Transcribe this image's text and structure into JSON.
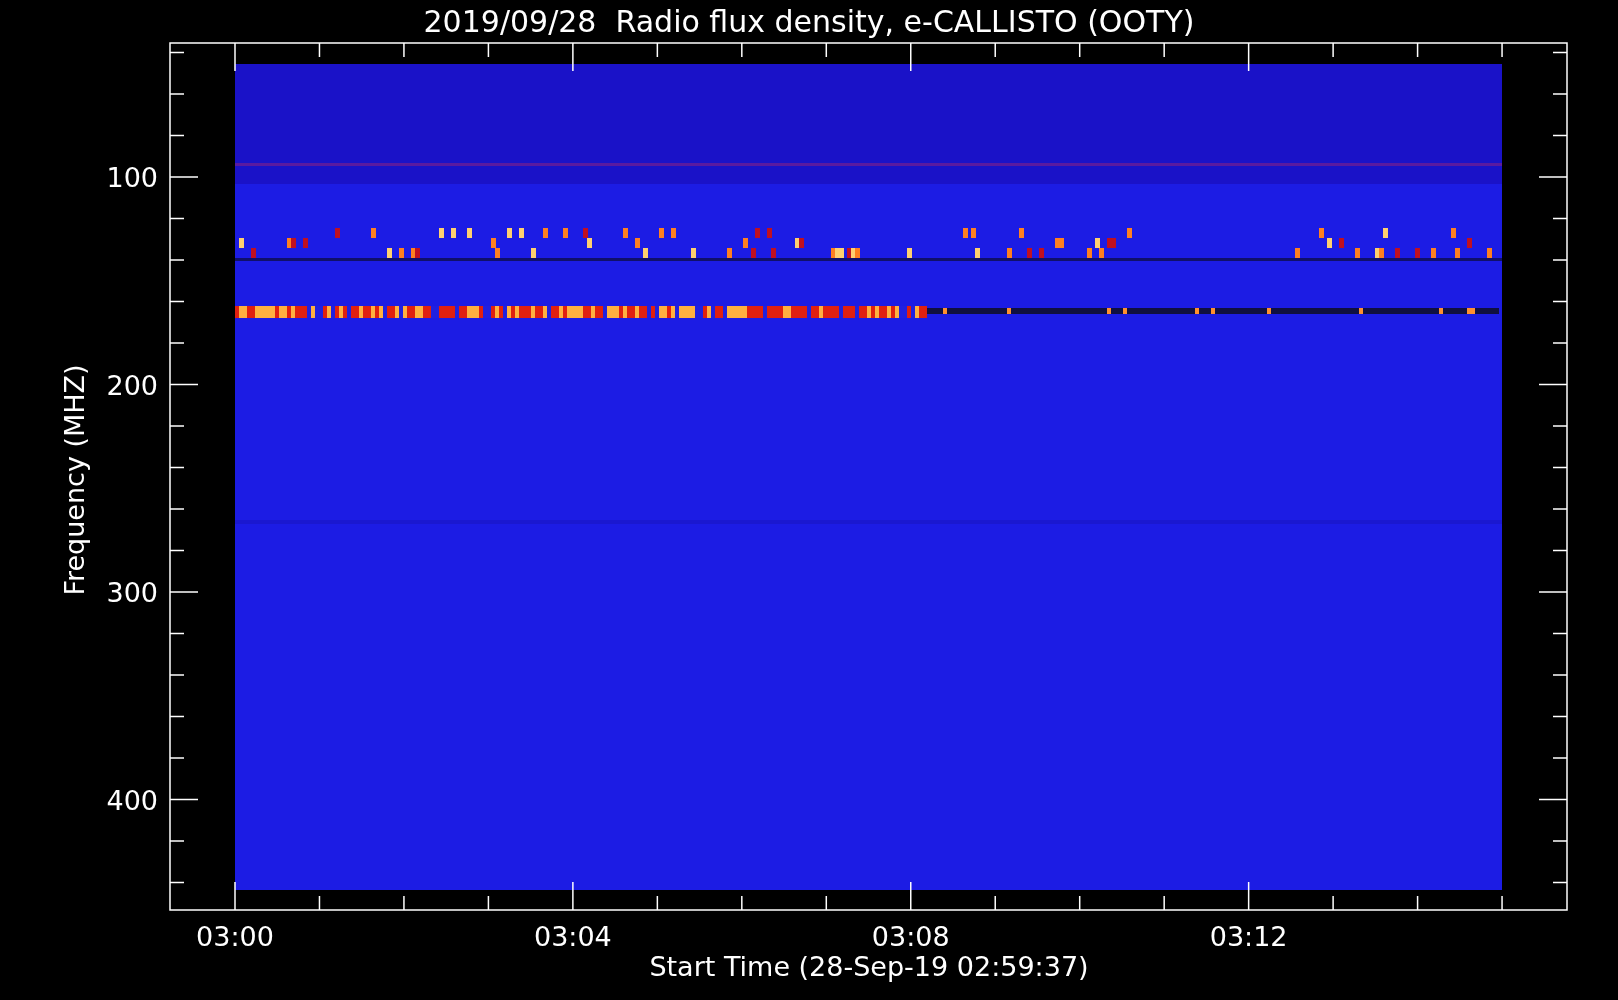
{
  "title": "2019/09/28  Radio flux density, e-CALLISTO (OOTY)",
  "y_axis": {
    "label": "Frequency (MHZ)",
    "ticks": [
      "100",
      "200",
      "300",
      "400"
    ]
  },
  "x_axis": {
    "label": "Start Time (28-Sep-19 02:59:37)",
    "ticks": [
      "03:00",
      "03:04",
      "03:08",
      "03:12"
    ]
  }
}
